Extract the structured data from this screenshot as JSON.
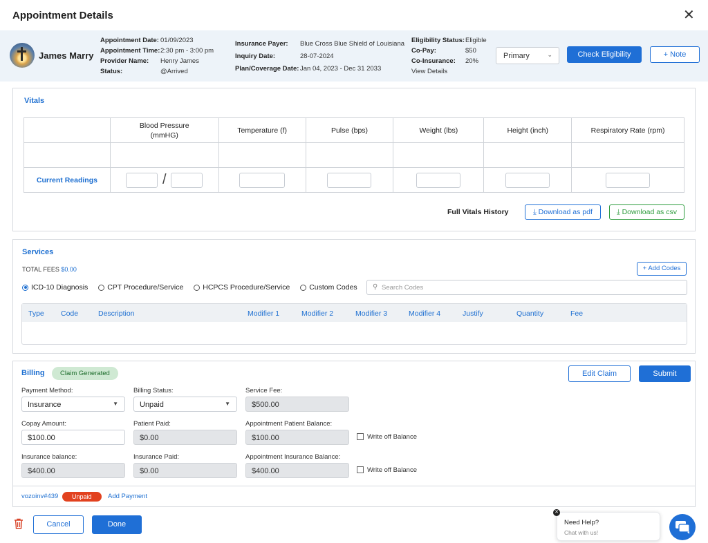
{
  "header": {
    "title": "Appointment Details"
  },
  "patient": {
    "name": "James Marry",
    "col1": [
      {
        "label": "Appointment Date:",
        "value": "01/09/2023"
      },
      {
        "label": "Appointment Time:",
        "value": "2:30 pm - 3:00 pm"
      },
      {
        "label": "Provider Name:",
        "value": "Henry James"
      },
      {
        "label": "Status:",
        "value": "@Arrived"
      }
    ],
    "col2": [
      {
        "label": "Insurance Payer:",
        "value": "Blue Cross Blue Shield of Louisiana"
      },
      {
        "label": "Inquiry Date:",
        "value": "28-07-2024"
      },
      {
        "label": "Plan/Coverage Date:",
        "value": "Jan 04, 2023 - Dec 31 2033"
      }
    ],
    "col3": [
      {
        "label": "Eligibility Status:",
        "value": "Eligible"
      },
      {
        "label": "Co-Pay:",
        "value": "$50"
      },
      {
        "label": "Co-Insurance:",
        "value": "20%"
      }
    ],
    "view_details": "View Details",
    "plan_select": "Primary",
    "check_eligibility": "Check Eligibility",
    "note": "+ Note"
  },
  "vitals": {
    "title": "Vitals",
    "columns": [
      "Blood Pressure (mmHG)",
      "Temperature (f)",
      "Pulse (bps)",
      "Weight (lbs)",
      "Height (inch)",
      "Respiratory Rate (rpm)"
    ],
    "row_label": "Current Readings",
    "bp_separator": "/",
    "history_label": "Full Vitals History",
    "download_pdf": "Download as pdf",
    "download_csv": "Download as csv"
  },
  "services": {
    "title": "Services",
    "total_label": "TOTAL FEES",
    "total_value": "$0.00",
    "add_codes": "+ Add Codes",
    "options": [
      "ICD-10 Diagnosis",
      "CPT Procedure/Service",
      "HCPCS Procedure/Service",
      "Custom Codes"
    ],
    "selected_option": "ICD-10 Diagnosis",
    "search_placeholder": "Search Codes",
    "columns": [
      "Type",
      "Code",
      "Description",
      "Modifier 1",
      "Modifier 2",
      "Modifier 3",
      "Modifier 4",
      "Justify",
      "Quantity",
      "Fee"
    ]
  },
  "billing": {
    "title": "Billing",
    "badge": "Claim Generated",
    "edit_claim": "Edit Claim",
    "submit": "Submit",
    "payment_method_label": "Payment Method:",
    "payment_method": "Insurance",
    "billing_status_label": "Billing Status:",
    "billing_status": "Unpaid",
    "service_fee_label": "Service Fee:",
    "service_fee": "$500.00",
    "copay_label": "Copay Amount:",
    "copay": "$100.00",
    "patient_paid_label": "Patient Paid:",
    "patient_paid": "$0.00",
    "appt_patient_balance_label": "Appointment Patient Balance:",
    "appt_patient_balance": "$100.00",
    "write_off_1": "Write off Balance",
    "insurance_balance_label": "Insurance balance:",
    "insurance_balance": "$400.00",
    "insurance_paid_label": "Insurance Paid:",
    "insurance_paid": "$0.00",
    "appt_insurance_balance_label": "Appointment Insurance Balance:",
    "appt_insurance_balance": "$400.00",
    "write_off_2": "Write off Balance",
    "invoice": "vozoinv#439",
    "invoice_status": "Unpaid",
    "add_payment": "Add Payment"
  },
  "footer": {
    "cancel": "Cancel",
    "done": "Done",
    "help_title": "Need Help?",
    "help_sub": "Chat with us!"
  }
}
